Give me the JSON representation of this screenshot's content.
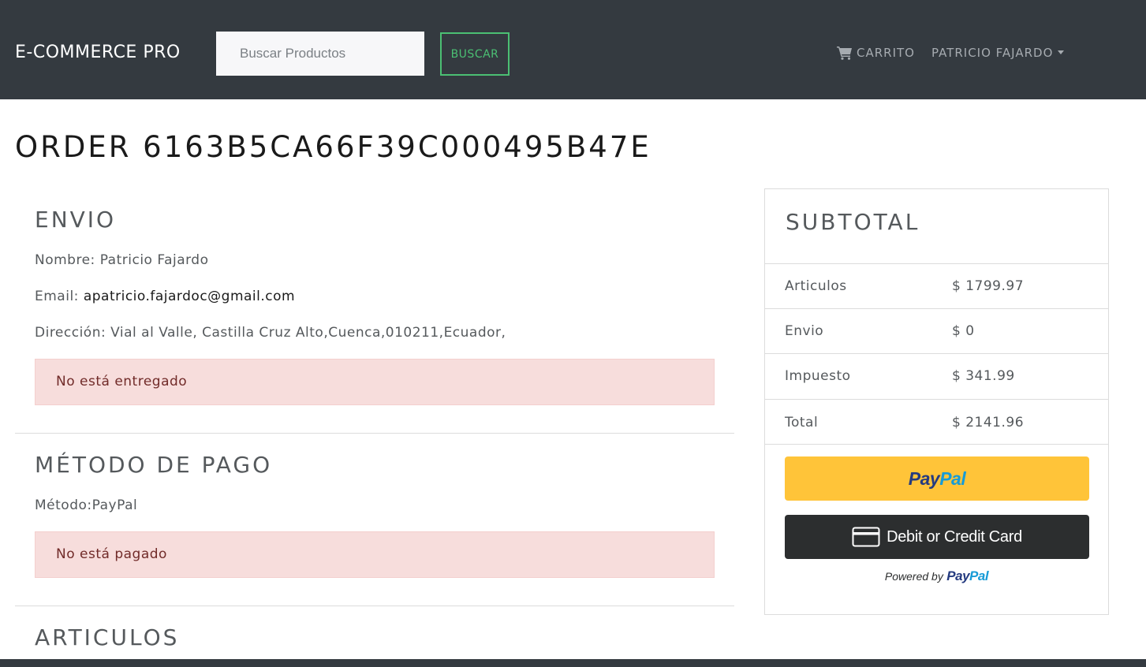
{
  "navbar": {
    "brand": "E-COMMERCE PRO",
    "search_placeholder": "Buscar Productos",
    "search_button": "BUSCAR",
    "cart_label": "CARRITO",
    "user_label": "PATRICIO FAJARDO",
    "cart_icon": "shopping-cart-icon",
    "background": "#343a40",
    "accent": "#4bbf73"
  },
  "order": {
    "title": "ORDER 6163B5CA66F39C000495B47E"
  },
  "shipping": {
    "heading": "ENVIO",
    "name_label": "Nombre:",
    "name_value": "Patricio Fajardo",
    "email_label": "Email:",
    "email_value": "apatricio.fajardoc@gmail.com",
    "address_label": "Dirección:",
    "address_value": "Vial al Valle, Castilla Cruz Alto,Cuenca,010211,Ecuador,",
    "status": "No está entregado"
  },
  "payment": {
    "heading": "MÉTODO DE PAGO",
    "method_label": "Método:",
    "method_value": "PayPal",
    "status": "No está pagado"
  },
  "items": {
    "heading": "ARTICULOS"
  },
  "summary": {
    "heading": "SUBTOTAL",
    "rows": [
      {
        "label": "Articulos",
        "value": "$ 1799.97"
      },
      {
        "label": "Envio",
        "value": "$ 0"
      },
      {
        "label": "Impuesto",
        "value": "$ 341.99"
      },
      {
        "label": "Total",
        "value": "$ 2141.96"
      }
    ]
  },
  "paypal": {
    "logo_pay": "Pay",
    "logo_pal": "Pal",
    "card_button": "Debit or Credit Card",
    "card_icon": "credit-card-icon",
    "powered_by": "Powered by",
    "button_color": "#ffc439",
    "card_button_color": "#2c2e2f"
  },
  "alert_color": "#f7dddc"
}
